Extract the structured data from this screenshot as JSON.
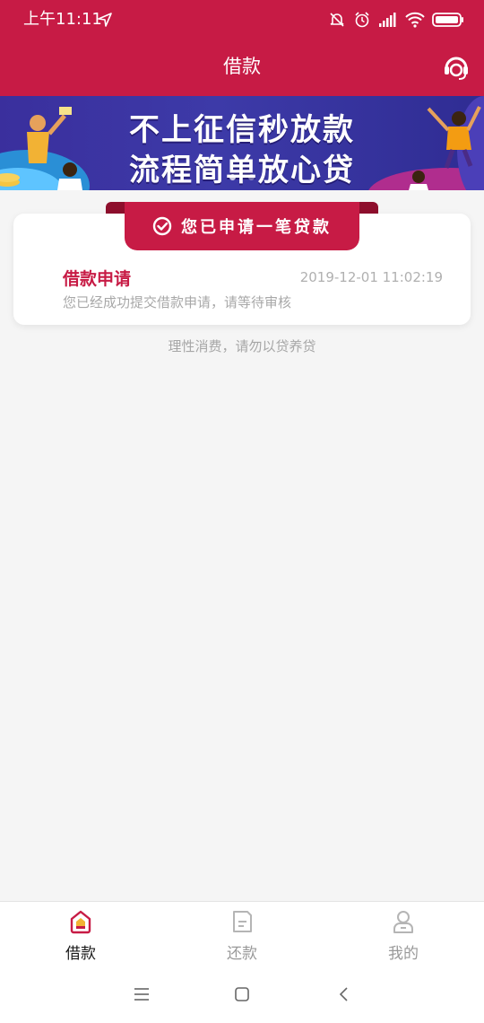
{
  "status_bar": {
    "time": "上午11:11"
  },
  "header": {
    "title": "借款",
    "support_icon": "headset-icon"
  },
  "banner": {
    "line1": "不上征信秒放款",
    "line2": "流程简单放心贷",
    "slide_count": 2,
    "active_slide": 1
  },
  "application_card": {
    "ribbon_text": "您已申请一笔贷款",
    "title": "借款申请",
    "time": "2019-12-01 11:02:19",
    "description": "您已经成功提交借款申请，请等待审核"
  },
  "footer_tip": "理性消费，请勿以贷养贷",
  "tabs": [
    {
      "label": "借款",
      "icon": "home-icon",
      "active": true
    },
    {
      "label": "还款",
      "icon": "document-icon",
      "active": false
    },
    {
      "label": "我的",
      "icon": "user-icon",
      "active": false
    }
  ],
  "colors": {
    "primary": "#c71b45",
    "banner": "#3a2f9d"
  }
}
